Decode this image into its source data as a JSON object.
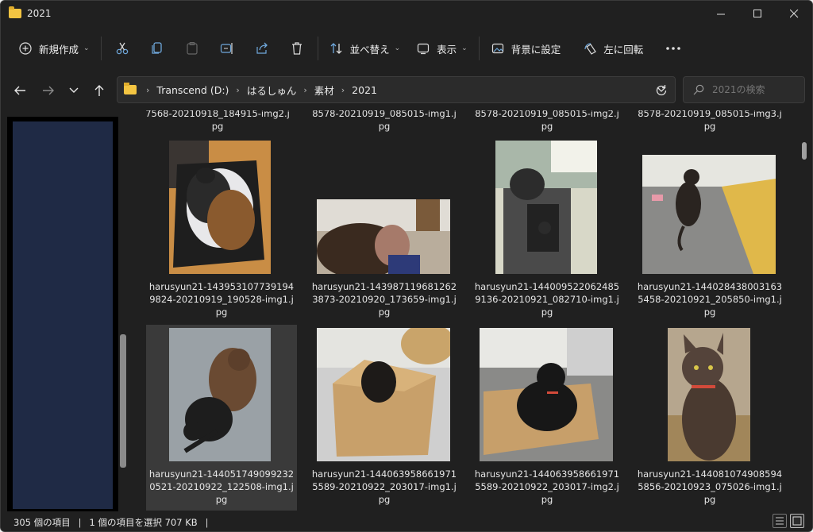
{
  "window": {
    "title": "2021"
  },
  "commands": {
    "new": "新規作成",
    "sort": "並べ替え",
    "view": "表示",
    "set_background": "背景に設定",
    "rotate_left": "左に回転"
  },
  "address": {
    "crumbs": [
      "Transcend (D:)",
      "はるしゅん",
      "素材",
      "2021"
    ]
  },
  "search": {
    "placeholder": "2021の検索"
  },
  "files": {
    "top_row": [
      "7568-20210918_184915-img2.j\npg",
      "8578-20210919_085015-img1.j\npg",
      "8578-20210919_085015-img2.j\npg",
      "8578-20210919_085015-img3.j\npg"
    ],
    "row1": [
      "harusyun21-143953107739194\n9824-20210919_190528-img1.j\npg",
      "harusyun21-143987119681262\n3873-20210920_173659-img1.j\npg",
      "harusyun21-144009522062485\n9136-20210921_082710-img1.j\npg",
      "harusyun21-144028438003163\n5458-20210921_205850-img1.j\npg"
    ],
    "row2": [
      "harusyun21-144051749099232\n0521-20210922_122508-img1.j\npg",
      "harusyun21-144063958661971\n5589-20210922_203017-img1.j\npg",
      "harusyun21-144063958661971\n5589-20210922_203017-img2.j\npg",
      "harusyun21-144081074908594\n5856-20210923_075026-img1.j\npg"
    ]
  },
  "status": {
    "count": "305 個の項目",
    "selected": "1 個の項目を選択  707 KB"
  }
}
